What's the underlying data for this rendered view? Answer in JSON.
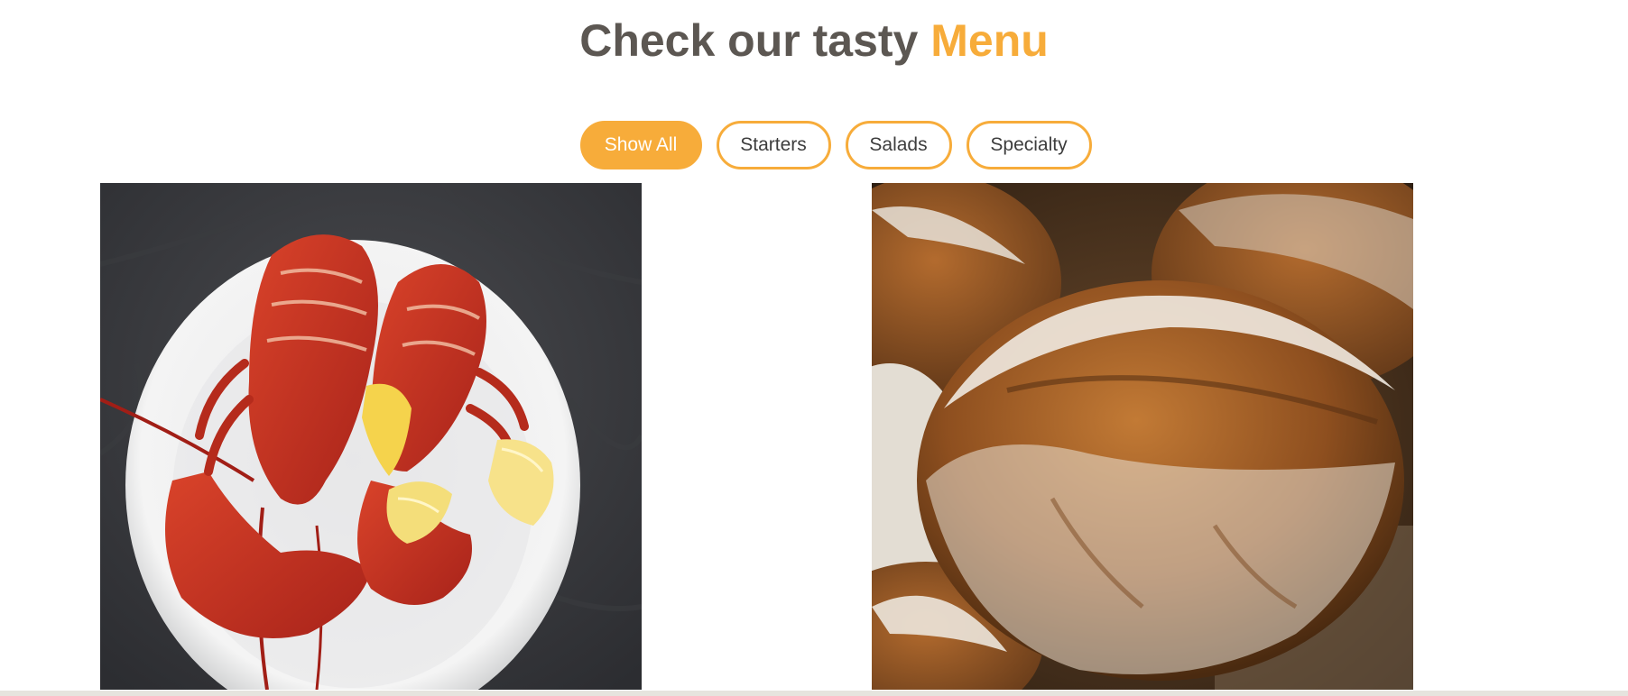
{
  "section": {
    "title_main": "Check our tasty ",
    "title_accent": "Menu"
  },
  "filters": [
    {
      "label": "Show All",
      "active": true
    },
    {
      "label": "Starters",
      "active": false
    },
    {
      "label": "Salads",
      "active": false
    },
    {
      "label": "Specialty",
      "active": false
    }
  ],
  "menu_items": [
    {
      "image": "lobster-plate-image"
    },
    {
      "image": "bread-loaves-image"
    }
  ],
  "colors": {
    "accent": "#f7ac3a",
    "heading": "#5c5752",
    "button_text": "#3d3d3d"
  }
}
